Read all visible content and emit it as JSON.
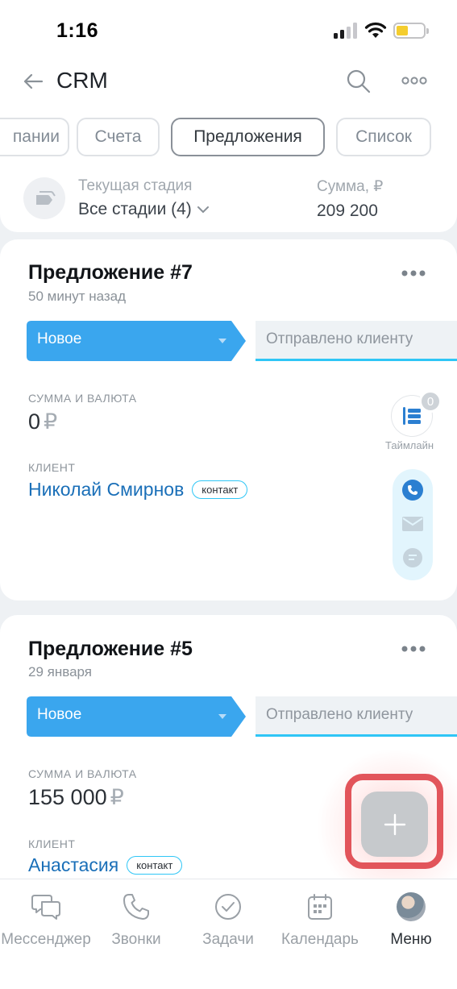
{
  "status_bar": {
    "time": "1:16"
  },
  "nav": {
    "title": "CRM"
  },
  "tabs": [
    {
      "label": "пании",
      "active": false
    },
    {
      "label": "Счета",
      "active": false
    },
    {
      "label": "Предложения",
      "active": true
    },
    {
      "label": "Список",
      "active": false
    }
  ],
  "stage_summary": {
    "stage_label": "Текущая стадия",
    "stage_value": "Все стадии (4)",
    "sum_label": "Сумма, ₽",
    "sum_value": "209 200"
  },
  "cards": [
    {
      "title": "Предложение #7",
      "date": "50 минут назад",
      "stage": "Новое",
      "next_stage": "Отправлено клиенту",
      "amount_label": "СУММА И ВАЛЮТА",
      "amount": "0",
      "currency": "₽",
      "client_label": "КЛИЕНТ",
      "client_name": "Николай Смирнов",
      "client_badge": "контакт",
      "timeline_count": "0",
      "timeline_label": "Таймлайн"
    },
    {
      "title": "Предложение #5",
      "date": "29 января",
      "stage": "Новое",
      "next_stage": "Отправлено клиенту",
      "amount_label": "СУММА И ВАЛЮТА",
      "amount": "155 000",
      "currency": "₽",
      "client_label": "КЛИЕНТ",
      "client_name": "Анастасия",
      "client_badge": "контакт"
    }
  ],
  "tabbar": [
    {
      "label": "Мессенджер",
      "icon": "messenger-icon",
      "active": false
    },
    {
      "label": "Звонки",
      "icon": "phone-icon",
      "active": false
    },
    {
      "label": "Задачи",
      "icon": "tasks-icon",
      "active": false
    },
    {
      "label": "Календарь",
      "icon": "calendar-icon",
      "active": false
    },
    {
      "label": "Меню",
      "icon": "avatar",
      "active": true
    }
  ],
  "colors": {
    "accent_blue": "#3aa6ee",
    "link_blue": "#1a6fb8",
    "highlight_red": "#e2555b",
    "progress_cyan": "#2fc6f6"
  }
}
